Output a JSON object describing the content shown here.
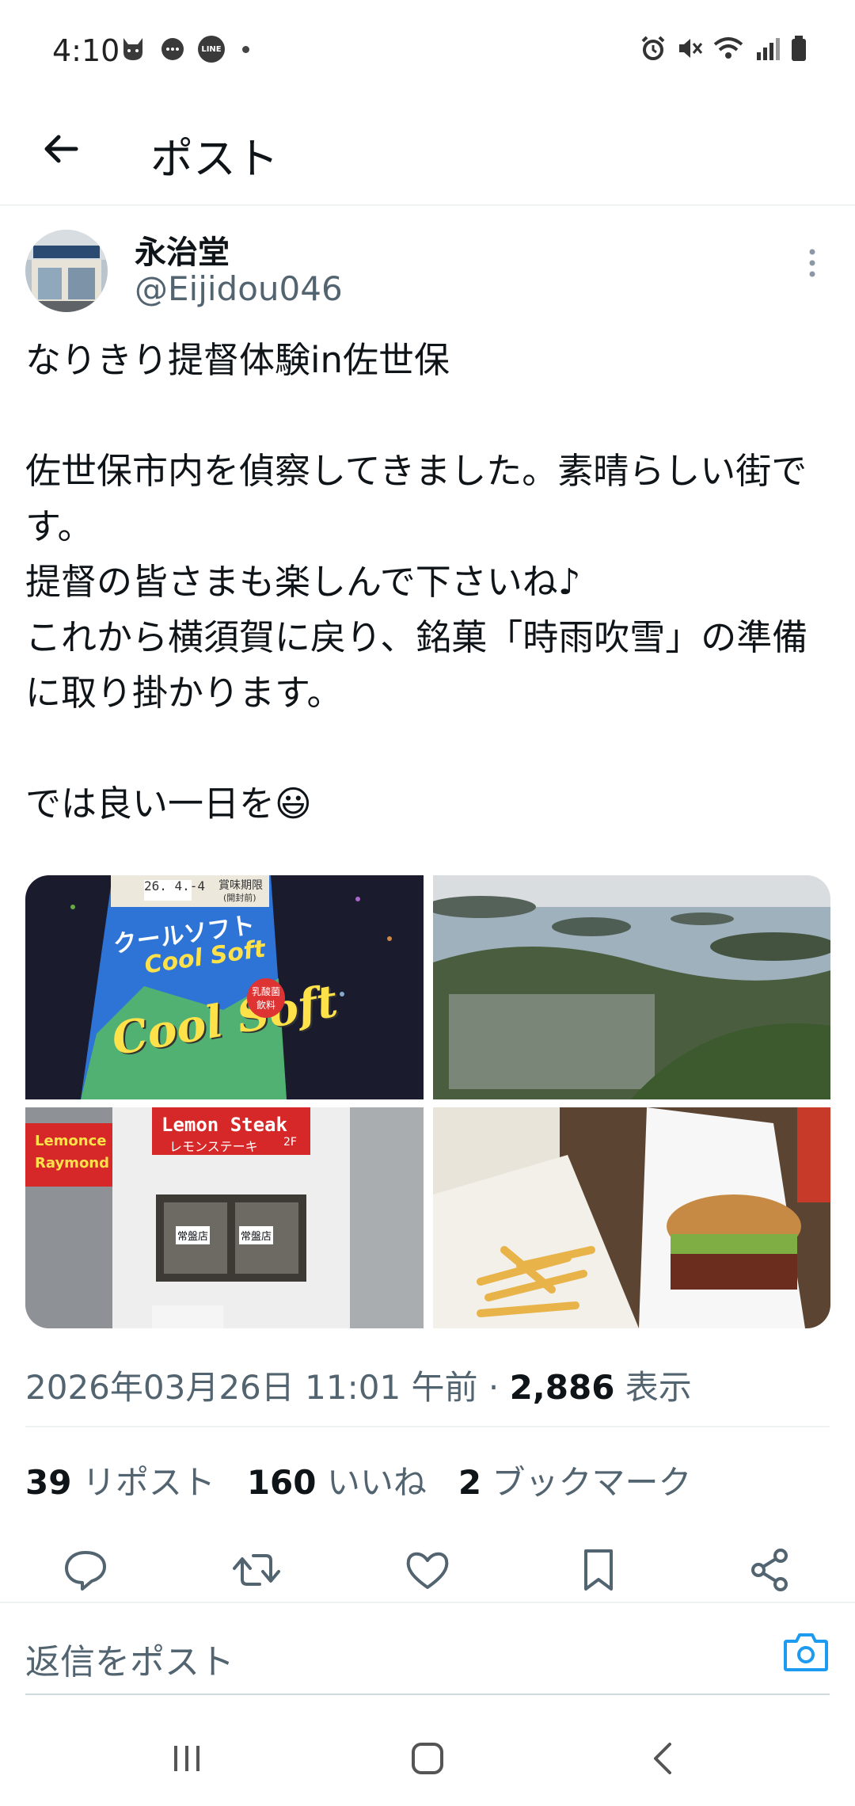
{
  "status_bar": {
    "time": "4:10",
    "left_icons": [
      "cat-icon",
      "chat-icon",
      "line-icon"
    ],
    "right_icons": [
      "alarm-icon",
      "mute-icon",
      "wifi-icon",
      "signal-icon",
      "battery-icon"
    ],
    "line_label": "LINE"
  },
  "header": {
    "title": "ポスト"
  },
  "post": {
    "author_name": "永治堂",
    "handle": "@Eijidou046",
    "body": [
      "なりきり提督体験in佐世保",
      "",
      "佐世保市内を偵察してきました。素晴らしい街です。",
      "提督の皆さまも楽しんで下さいね♪",
      "これから横須賀に戻り、銘菓「時雨吹雪」の準備に取り掛かります。",
      "",
      "では良い一日を😃"
    ],
    "images": {
      "top_left": {
        "pack_text_1": "クールソフト",
        "pack_text_2": "Cool Soft",
        "pack_text_3": "Cool Soft",
        "pack_label": "乳酸菌飲料",
        "date": "26. 4.-4",
        "expiry": "賞味期限",
        "expiry_sub": "(開封前)"
      },
      "bottom_left": {
        "sign_en": "Lemon Steak",
        "sign_jp": "レモンステーキ",
        "sign_floor": "2F",
        "side_sign_1": "Lemonce",
        "side_sign_2": "Raymond",
        "door_label_1": "常盤店",
        "door_label_2": "常盤店"
      }
    },
    "timestamp": "2026年03月26日 11:01 午前 · ",
    "views_count": "2,886",
    "views_label": " 表示",
    "stats": {
      "reposts_count": "39",
      "reposts_label": "リポスト",
      "likes_count": "160",
      "likes_label": "いいね",
      "bookmarks_count": "2",
      "bookmarks_label": "ブックマーク"
    }
  },
  "reply": {
    "placeholder": "返信をポスト"
  },
  "colors": {
    "text": "#0f1419",
    "muted": "#536471",
    "accent": "#1d9bf0",
    "divider": "#eff3f4"
  }
}
